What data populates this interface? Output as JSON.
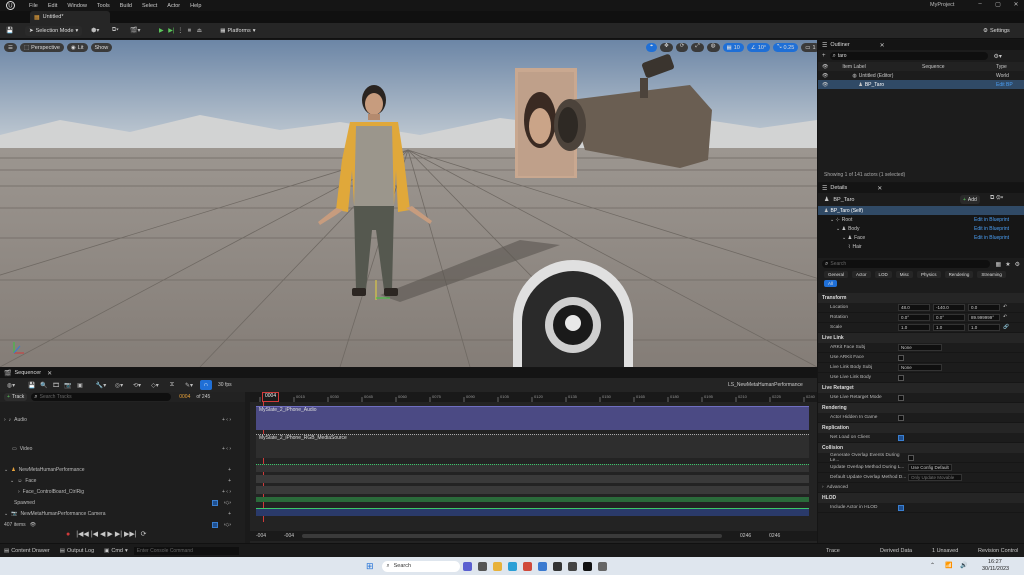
{
  "titlebar": {
    "menu": [
      "File",
      "Edit",
      "Window",
      "Tools",
      "Build",
      "Select",
      "Actor",
      "Help"
    ],
    "project": "MyProject"
  },
  "tab": {
    "label": "Untitled*"
  },
  "toolbar": {
    "selection_mode": "Selection Mode",
    "platforms": "Platforms",
    "settings": "Settings"
  },
  "viewport": {
    "perspective": "Perspective",
    "lit": "Lit",
    "show": "Show",
    "grid_value": "10",
    "angle_value": "10°",
    "scale_value": "0.25",
    "cam_speed": "1"
  },
  "sequencer": {
    "panel_title": "Sequencer",
    "sequence_name": "LS_NewMetaHumanPerformance",
    "track_button": "Track",
    "search_placeholder": "Search Tracks",
    "fps": "30 fps",
    "frame": "0004",
    "of_frames": "of 245",
    "playhead": "0004",
    "ruler": [
      "0000",
      "0015",
      "0030",
      "0045",
      "0060",
      "0075",
      "0090",
      "0105",
      "0120",
      "0135",
      "0150",
      "0165",
      "0180",
      "0195",
      "0210",
      "0225",
      "0240"
    ],
    "tracks": [
      "Audio",
      "Video",
      "NewMetaHumanPerformance",
      "Face",
      "Face_ControlBoard_CtrlRig",
      "Spawned",
      "NewMetaHumanPerformance Camera"
    ],
    "clip_audio": "MySlate_2_iPhone_Audio",
    "clip_video": "MySlate_2_iPhone_RGB_MediaSource",
    "items_count": "407 items",
    "range_start": "-004",
    "range_start2": "-004",
    "range_end": "0246",
    "range_end2": "0246"
  },
  "outliner": {
    "title": "Outliner",
    "search_value": "taro",
    "col_label": "Item Label",
    "col_sequence": "Sequence",
    "col_type": "Type",
    "rows": [
      {
        "label": "Untitled (Editor)",
        "type": "World"
      },
      {
        "label": "BP_Taro",
        "type": "Edit BP"
      }
    ],
    "status": "Showing 1 of 141 actors (1 selected)"
  },
  "details": {
    "title": "Details",
    "actor": "BP_Taro",
    "add_label": "Add",
    "self_label": "BP_Taro (Self)",
    "components": [
      {
        "label": "Root",
        "link": "Edit in Blueprint"
      },
      {
        "label": "Body",
        "link": "Edit in Blueprint"
      },
      {
        "label": "Face",
        "link": "Edit in Blueprint"
      },
      {
        "label": "Hair",
        "link": ""
      }
    ],
    "search_placeholder": "Search",
    "filter_tabs": [
      "General",
      "Actor",
      "LOD",
      "Misc",
      "Physics",
      "Rendering",
      "Streaming",
      "All"
    ],
    "transform": {
      "title": "Transform",
      "location_label": "Location",
      "location": [
        "48.0",
        "-140.0",
        "0.0"
      ],
      "rotation_label": "Rotation",
      "rotation": [
        "0.0°",
        "0.0°",
        "89.999999°"
      ],
      "scale_label": "Scale",
      "scale": [
        "1.0",
        "1.0",
        "1.0"
      ]
    },
    "livelink": {
      "title": "Live Link",
      "face_subj_label": "ARKit Face Subj",
      "face_subj_value": "None",
      "use_arkit_label": "Use ARKit Face",
      "body_subj_label": "Live Link Body Subj",
      "body_subj_value": "None",
      "use_body_label": "Use Live Link Body"
    },
    "retarget": {
      "title": "Live Retarget",
      "label": "Use Live Retarget Mode"
    },
    "rendering": {
      "title": "Rendering",
      "label": "Actor Hidden In Game"
    },
    "replication": {
      "title": "Replication",
      "label": "Net Load on Client"
    },
    "collision": {
      "title": "Collision",
      "gen_overlap": "Generate Overlap Events During Le...",
      "update_overlap": "Update Overlap Method During L...",
      "update_value": "Use Config Default",
      "default_overlap": "Default Update Overlap Method D...",
      "default_value": "Only Update Movable"
    },
    "advanced": "Advanced",
    "hlod": {
      "title": "HLOD",
      "label": "Include Actor in HLOD"
    }
  },
  "statusbar": {
    "content_drawer": "Content Drawer",
    "output_log": "Output Log",
    "cmd": "Cmd",
    "console_placeholder": "Enter Console Command",
    "trace": "Trace",
    "derived": "Derived Data",
    "unsaved": "1 Unsaved",
    "revision": "Revision Control"
  },
  "taskbar": {
    "search": "Search",
    "time": "16:27",
    "date": "30/11/2023"
  },
  "colors": {
    "accent": "#1f6fd6",
    "link": "#4a9ff5",
    "clip_audio": "#4b4a84",
    "selected_row": "#304a66"
  }
}
